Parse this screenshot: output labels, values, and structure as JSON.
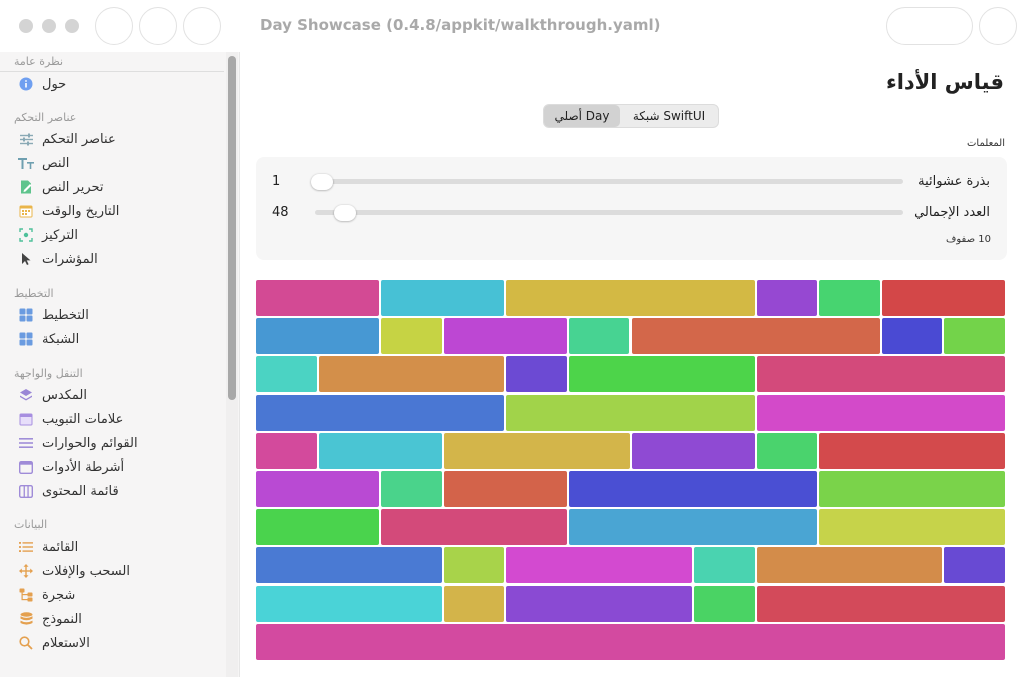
{
  "window": {
    "title": "Day Showcase (0.4.8/appkit/walkthrough.yaml)"
  },
  "sidebar": {
    "sections": [
      {
        "header": "نظرة عامة",
        "items": [
          {
            "label": "حول",
            "icon": "info-icon"
          }
        ]
      },
      {
        "header": "عناصر التحكم",
        "items": [
          {
            "label": "عناصر التحكم",
            "icon": "sliders-icon"
          },
          {
            "label": "النص",
            "icon": "text-size-icon"
          },
          {
            "label": "تحرير النص",
            "icon": "edit-document-icon"
          },
          {
            "label": "التاريخ والوقت",
            "icon": "calendar-icon"
          },
          {
            "label": "التركيز",
            "icon": "focus-icon"
          },
          {
            "label": "المؤشرات",
            "icon": "pointer-icon"
          }
        ]
      },
      {
        "header": "التخطيط",
        "items": [
          {
            "label": "التخطيط",
            "icon": "layout-grid-icon"
          },
          {
            "label": "الشبكة",
            "icon": "grid-icon"
          }
        ]
      },
      {
        "header": "التنقل والواجهة",
        "items": [
          {
            "label": "المكدس",
            "icon": "stack-icon"
          },
          {
            "label": "علامات التبويب",
            "icon": "tabs-icon"
          },
          {
            "label": "القوائم والحوارات",
            "icon": "menu-lines-icon"
          },
          {
            "label": "أشرطة الأدوات",
            "icon": "toolbar-icon"
          },
          {
            "label": "قائمة المحتوى",
            "icon": "columns-icon"
          }
        ]
      },
      {
        "header": "البيانات",
        "items": [
          {
            "label": "القائمة",
            "icon": "list-icon"
          },
          {
            "label": "السحب والإفلات",
            "icon": "move-arrows-icon"
          },
          {
            "label": "شجرة",
            "icon": "tree-icon"
          },
          {
            "label": "النموذج",
            "icon": "database-icon"
          },
          {
            "label": "الاستعلام",
            "icon": "search-icon"
          }
        ]
      }
    ]
  },
  "main": {
    "title": "قياس الأداء",
    "segmented": {
      "left": "أصلي Day",
      "right": "شبكة SwiftUI",
      "selected": "left"
    },
    "params_label": "المعلمات",
    "params": {
      "seed": {
        "label": "بذرة عشوائية",
        "value": "1",
        "fraction": 0.0
      },
      "total": {
        "label": "العدد الإجمالي",
        "value": "48",
        "fraction": 0.04
      },
      "rows_note": "10 صفوف"
    }
  },
  "grid_rows": [
    [
      [
        "#d34a94",
        2
      ],
      [
        "#47c1d5",
        2
      ],
      [
        "#d3b944",
        4
      ],
      [
        "#9648d2",
        1
      ],
      [
        "#47d470",
        1
      ],
      [
        "#d34748",
        2
      ]
    ],
    [
      [
        "#4798d3",
        2
      ],
      [
        "#c6d344",
        1
      ],
      [
        "#bd47d3",
        2
      ],
      [
        "#47d392",
        1
      ],
      [
        "#d3674a",
        4
      ],
      [
        "#4a4ad3",
        1
      ],
      [
        "#73d34a",
        1
      ]
    ],
    [
      [
        "#4bd3c3",
        1
      ],
      [
        "#d38f4a",
        3
      ],
      [
        "#6c4ad3",
        1
      ],
      [
        "#4dd44a",
        3
      ],
      [
        "#d34a7b",
        4
      ]
    ],
    [
      [
        "#4a77d3",
        4
      ],
      [
        "#a1d34a",
        4
      ],
      [
        "#d34ac9",
        4
      ]
    ],
    [
      [
        "#d34a9c",
        1
      ],
      [
        "#4ac5d3",
        2
      ],
      [
        "#d3b54a",
        3
      ],
      [
        "#8f4ad3",
        2
      ],
      [
        "#4ad36d",
        1
      ],
      [
        "#d34a4c",
        3
      ]
    ],
    [
      [
        "#b94ad3",
        2
      ],
      [
        "#4ad38b",
        1
      ],
      [
        "#d3634a",
        2
      ],
      [
        "#4a4fd3",
        4
      ],
      [
        "#7ad34a",
        3
      ]
    ],
    [
      [
        "#4ad34d",
        2
      ],
      [
        "#d34a7a",
        3
      ],
      [
        "#4aa5d3",
        4
      ],
      [
        "#c6d34a",
        3
      ]
    ],
    [
      [
        "#4a7ad3",
        3
      ],
      [
        "#a8d34a",
        1
      ],
      [
        "#d34ad0",
        3
      ],
      [
        "#4ad3b0",
        1
      ],
      [
        "#d38c4a",
        3
      ],
      [
        "#684ad3",
        1
      ]
    ],
    [
      [
        "#4ad3d7",
        3
      ],
      [
        "#d3b44a",
        1
      ],
      [
        "#8a4ad3",
        3
      ],
      [
        "#4ad364",
        1
      ],
      [
        "#d34a5a",
        4
      ]
    ],
    [
      [
        "#d34aa0",
        12
      ]
    ]
  ]
}
